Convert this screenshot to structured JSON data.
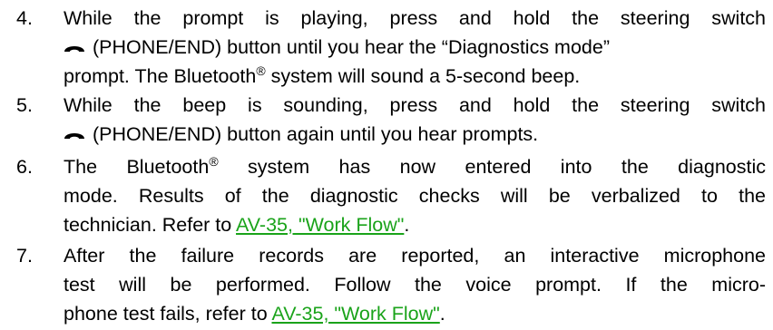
{
  "steps": [
    {
      "number": "4.",
      "line1": "While the prompt is playing, press and hold the steering switch",
      "line2_suffix": "(PHONE/END) button until you hear the “Diagnostics mode”",
      "line3_pre": "prompt. The Bluetooth",
      "line3_sup": "®",
      "line3_post": " system will sound a 5-second beep."
    },
    {
      "number": "5.",
      "line1": "While the beep is sounding, press and hold the steering switch",
      "line2_suffix": "(PHONE/END) button again until you hear prompts."
    },
    {
      "number": "6.",
      "line1_pre": "The Bluetooth",
      "line1_sup": "®",
      "line1_post": " system has now entered into the diagnostic",
      "line2": "mode. Results of the diagnostic checks will be verbalized to the",
      "line3_pre": "technician. Refer to ",
      "link": "AV-35, \"Work Flow\"",
      "line3_post": "."
    },
    {
      "number": "7.",
      "line1": "After the failure records are reported, an interactive microphone",
      "line2": "test will be performed. Follow the voice prompt. If the micro-",
      "line3_pre": "phone test fails, refer to ",
      "link": "AV-35, \"Work Flow\"",
      "line3_post": "."
    }
  ],
  "icons": {
    "phone": "phone-handset-icon"
  },
  "colors": {
    "link": "#1aa31a",
    "text": "#000000"
  }
}
